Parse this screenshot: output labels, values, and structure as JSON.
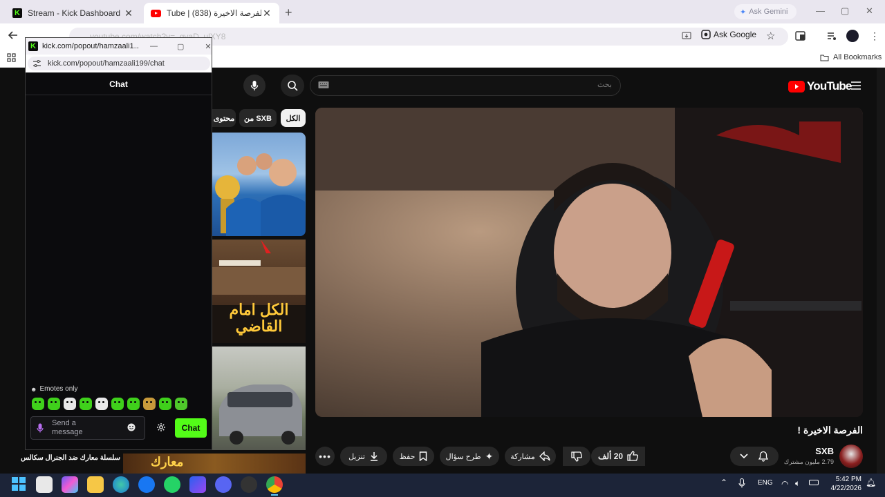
{
  "browser": {
    "tabs": [
      {
        "title": "Stream - Kick Dashboard",
        "active": false
      },
      {
        "title": "Tube | الفرصة الاخيرة (838)",
        "active": true
      }
    ],
    "new_tab": "+",
    "gemini_label": "Ask Gemini",
    "url": "youtube.com/watch?v=_qvaD_ulXY8",
    "ask_google": "Ask Google",
    "all_bookmarks": "All Bookmarks"
  },
  "kick_popout": {
    "window_title": "kick.com/popout/hamzaali1...",
    "url": "kick.com/popout/hamzaali199/chat",
    "chat_header": "Chat",
    "emotes_only": "Emotes only",
    "input_placeholder": "Send a message",
    "send_button": "Chat",
    "accent_color": "#53fc18"
  },
  "youtube": {
    "logo_text": "YouTube",
    "search_placeholder": "بحث",
    "chips": [
      "الكل",
      "من SXB",
      "محتوى"
    ],
    "video_title": "الفرصة الاخيرة !",
    "channel": {
      "name": "SXB",
      "subscribers": "2.79 مليون مشترك"
    },
    "actions": {
      "like_count": "20 ألف",
      "share": "مشاركة",
      "ask": "طرح سؤال",
      "save": "حفظ",
      "download": "تنزيل"
    },
    "sidebar_title": "سلسلة معارك ضد الجنرال سكالس!!! |",
    "thumbnail_texts": [
      "الكل امام القاضي",
      "معارك"
    ]
  },
  "taskbar": {
    "language": "ENG",
    "time": "5:42 PM",
    "date": "4/22/2026"
  }
}
